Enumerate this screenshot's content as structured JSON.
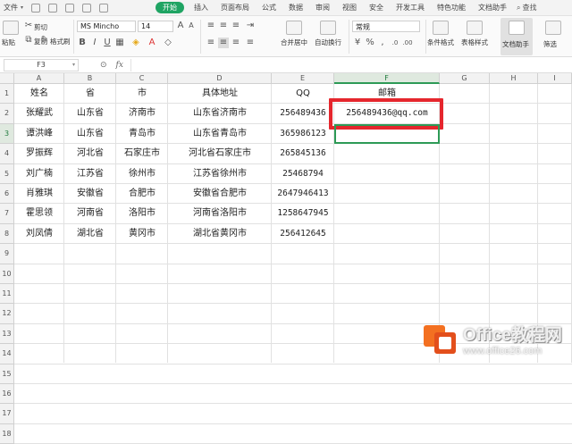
{
  "menubar": {
    "file_label": "文件",
    "tabs": [
      "开始",
      "插入",
      "页面布局",
      "公式",
      "数据",
      "审阅",
      "视图",
      "安全",
      "开发工具",
      "特色功能",
      "文档助手"
    ],
    "active_tab": "开始",
    "search_label": "查找"
  },
  "ribbon": {
    "paste_label": "粘贴",
    "cut_label": "剪切",
    "copy_label": "复制",
    "format_painter_label": "格式刷",
    "font_name": "MS Mincho",
    "font_size": "14",
    "merge_label": "合并居中",
    "wrap_label": "自动换行",
    "number_format": "常规",
    "conditional_format_label": "条件格式",
    "table_style_label": "表格样式",
    "doc_assistant_label": "文档助手",
    "filter_label": "筛选"
  },
  "formula_bar": {
    "name_box": "F3",
    "fx_label": "fx",
    "formula": ""
  },
  "sheet": {
    "columns": [
      "A",
      "B",
      "C",
      "D",
      "E",
      "F",
      "G",
      "H",
      "I"
    ],
    "rows": [
      "1",
      "2",
      "3",
      "4",
      "5",
      "6",
      "7",
      "8",
      "9",
      "10",
      "11",
      "12",
      "13",
      "14",
      "15",
      "16",
      "17",
      "18"
    ],
    "header": [
      "姓名",
      "省",
      "市",
      "具体地址",
      "QQ",
      "邮箱"
    ],
    "data": [
      [
        "张耀武",
        "山东省",
        "济南市",
        "山东省济南市",
        "256489436",
        "256489436@qq.com"
      ],
      [
        "谭洪峰",
        "山东省",
        "青岛市",
        "山东省青岛市",
        "365986123",
        ""
      ],
      [
        "罗振辉",
        "河北省",
        "石家庄市",
        "河北省石家庄市",
        "265845136",
        ""
      ],
      [
        "刘广楠",
        "江苏省",
        "徐州市",
        "江苏省徐州市",
        "25468794",
        ""
      ],
      [
        "肖雅琪",
        "安徽省",
        "合肥市",
        "安徽省合肥市",
        "2647946413",
        ""
      ],
      [
        "霍思领",
        "河南省",
        "洛阳市",
        "河南省洛阳市",
        "1258647945",
        ""
      ],
      [
        "刘凤倩",
        "湖北省",
        "黄冈市",
        "湖北省黄冈市",
        "256412645",
        ""
      ]
    ],
    "selected_cell": "F3",
    "highlight_color": "#e5262d",
    "selection_color": "#2d9a56"
  },
  "watermark": {
    "title": "Office教程网",
    "url": "www.office26.com"
  }
}
